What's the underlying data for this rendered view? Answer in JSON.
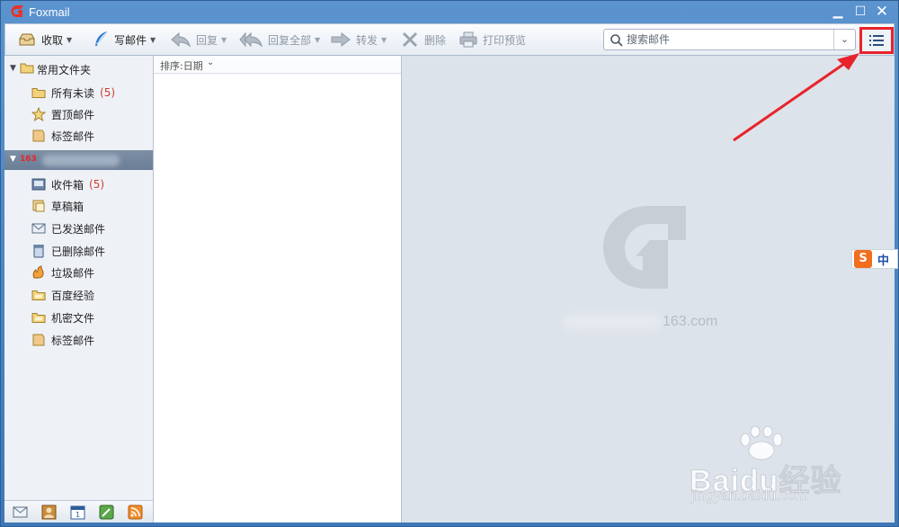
{
  "window": {
    "title": "Foxmail",
    "minimize_label": "▁",
    "maximize_label": "☐",
    "close_label": "✕"
  },
  "toolbar": {
    "receive_label": "收取",
    "compose_label": "写邮件",
    "reply_label": "回复",
    "reply_all_label": "回复全部",
    "forward_label": "转发",
    "delete_label": "删除",
    "print_preview_label": "打印预览"
  },
  "search": {
    "placeholder": "搜索邮件"
  },
  "sidebar": {
    "common_group_label": "常用文件夹",
    "common_items": [
      {
        "label": "所有未读",
        "count": "(5)",
        "icon": "folder-icon"
      },
      {
        "label": "置顶邮件",
        "count": "",
        "icon": "star-icon"
      },
      {
        "label": "标签邮件",
        "count": "",
        "icon": "tag-icon"
      }
    ],
    "account_badge": "163",
    "account_items": [
      {
        "label": "收件箱",
        "count": "(5)",
        "icon": "inbox-icon"
      },
      {
        "label": "草稿箱",
        "count": "",
        "icon": "draft-icon"
      },
      {
        "label": "已发送邮件",
        "count": "",
        "icon": "sent-icon"
      },
      {
        "label": "已删除邮件",
        "count": "",
        "icon": "trash-icon"
      },
      {
        "label": "垃圾邮件",
        "count": "",
        "icon": "spam-icon"
      },
      {
        "label": "百度经验",
        "count": "",
        "icon": "folder-icon"
      },
      {
        "label": "机密文件",
        "count": "",
        "icon": "folder-icon"
      },
      {
        "label": "标签邮件",
        "count": "",
        "icon": "tag-icon"
      }
    ],
    "bottom_buttons": [
      "mail-icon",
      "contacts-icon",
      "calendar-icon",
      "notes-icon",
      "rss-icon"
    ]
  },
  "message_list": {
    "sort_label": "排序:日期"
  },
  "preview": {
    "email_suffix": "163.com"
  },
  "ime": {
    "badge": "S",
    "label": "中"
  },
  "watermark": {
    "brand": "Baidu经验",
    "url": "jingyan.baidu.com"
  },
  "colors": {
    "accent_red": "#e8232b",
    "count_red": "#d13a2e",
    "title_blue": "#4a82bf"
  }
}
